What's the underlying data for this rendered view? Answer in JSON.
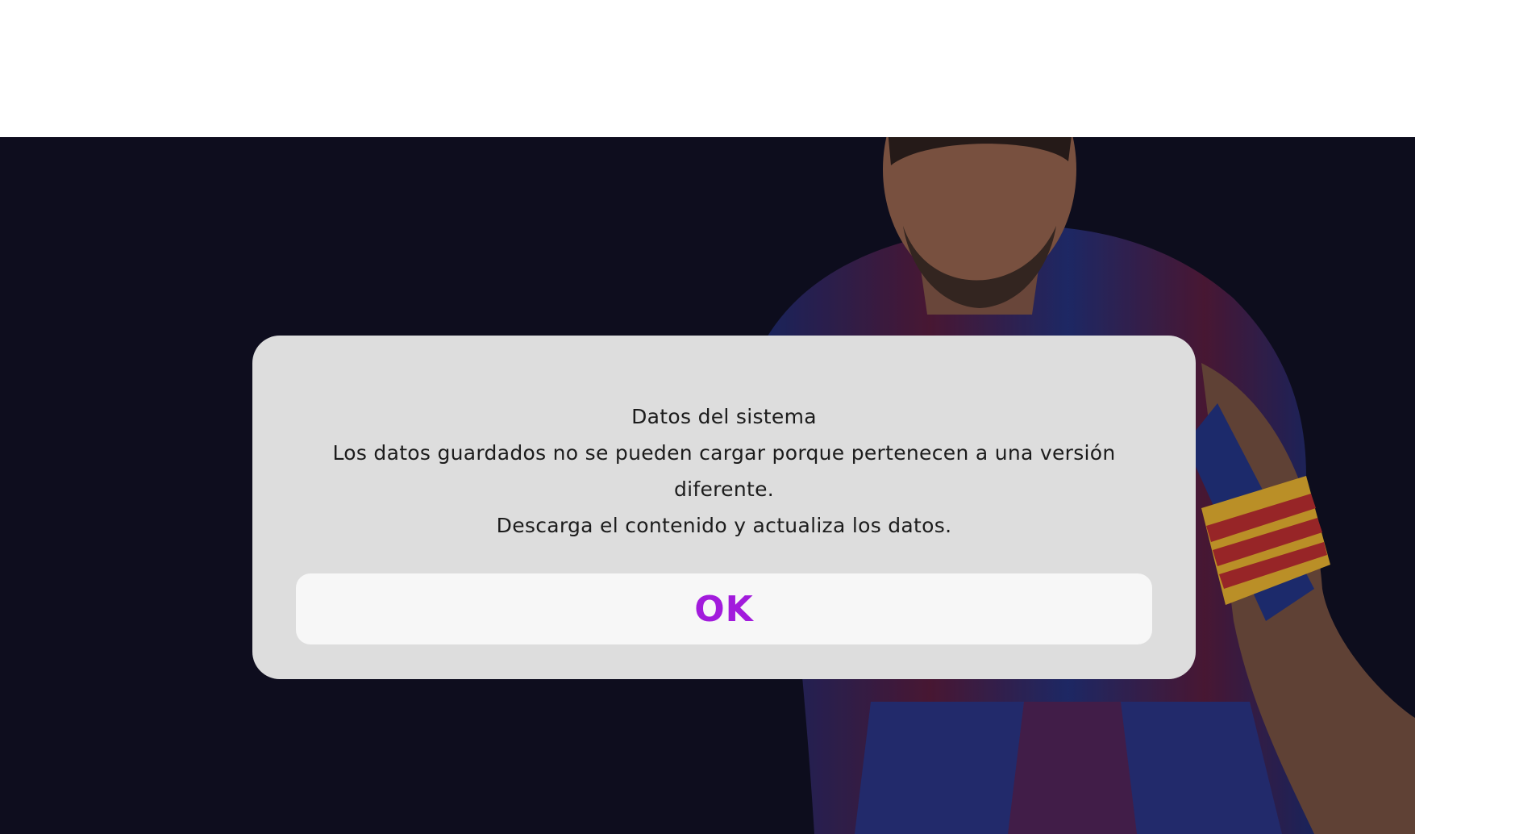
{
  "dialog": {
    "title": "Datos del sistema",
    "message_line1": "Los datos guardados no se pueden cargar porque pertenecen a una versión diferente.",
    "message_line2": "Descarga el contenido y actualiza los datos.",
    "ok_label": "OK"
  },
  "background": {
    "image": "football-player-artwork",
    "color": "#0e0d1e"
  },
  "colors": {
    "dialog_bg": "#dddddd",
    "button_bg": "#f7f7f7",
    "accent": "#a21bdc",
    "text": "#1c1c1c"
  }
}
